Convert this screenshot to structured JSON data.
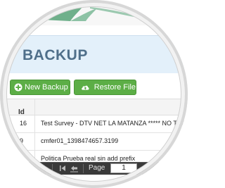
{
  "page": {
    "title": "BACKUP"
  },
  "toolbar": {
    "new_backup_label": "New Backup",
    "restore_file_label": "Restore File"
  },
  "table": {
    "column_id": "Id",
    "rows": [
      {
        "id": "16",
        "name": "Test Survey - DTV NET LA MATANZA ***** NO TOCAR ****"
      },
      {
        "id": "9",
        "name": "cmfer01_1398474657.3199"
      },
      {
        "id": "",
        "name": "Politica Prueba real sin add prefix"
      }
    ]
  },
  "pager": {
    "page_label": "Page",
    "page_value": "1"
  },
  "colors": {
    "accent_green": "#5cae46",
    "header_bg": "#e3f0fa",
    "title_color": "#4f6f8a"
  }
}
